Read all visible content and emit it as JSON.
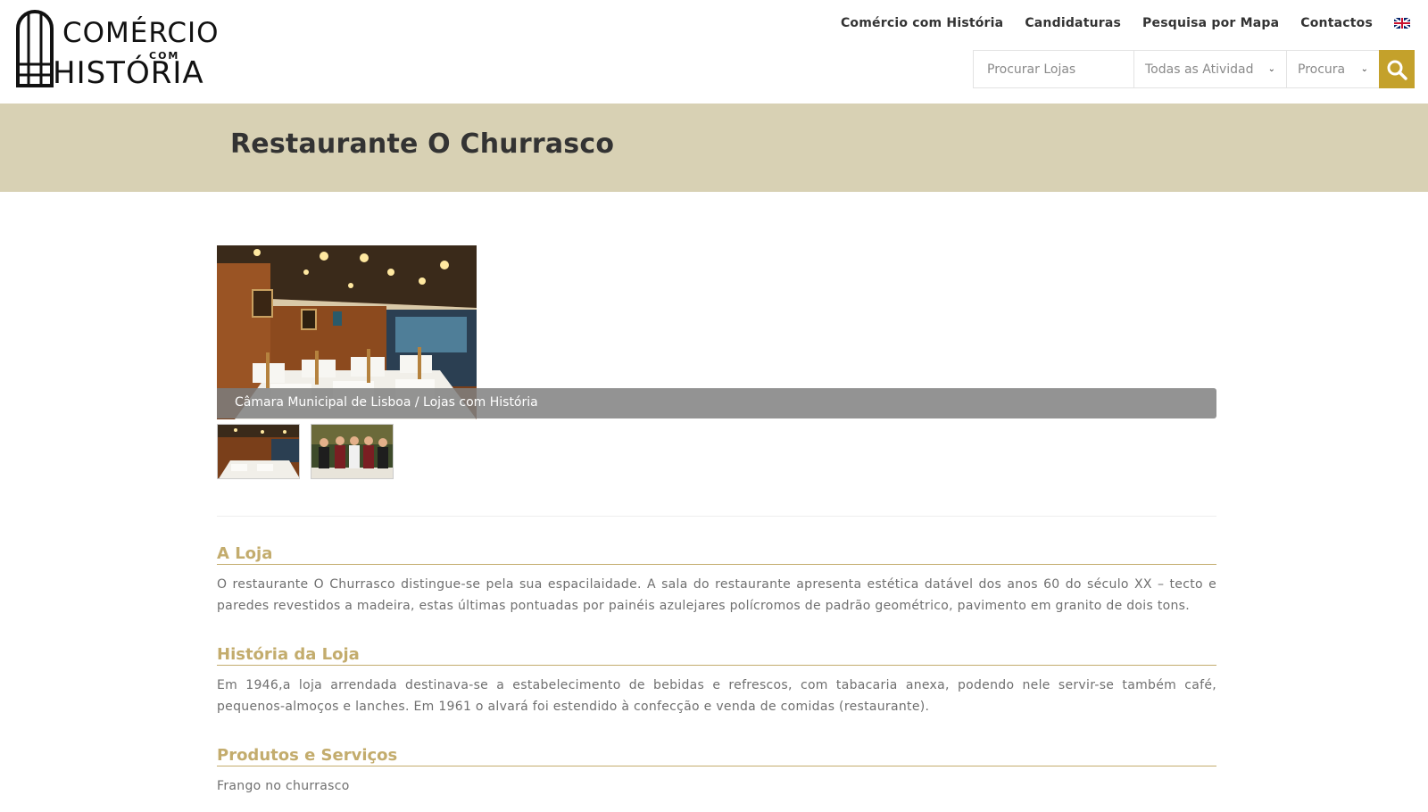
{
  "header": {
    "logo": {
      "line1": "COMÉRCIO",
      "line_com": "COM",
      "line2": "HISTÓRIA"
    },
    "nav": [
      {
        "label": "Comércio com História"
      },
      {
        "label": "Candidaturas"
      },
      {
        "label": "Pesquisa por Mapa"
      },
      {
        "label": "Contactos"
      }
    ],
    "language_icon": "uk-flag-icon",
    "search": {
      "placeholder": "Procurar Lojas",
      "activity_selected": "Todas as Atividad",
      "location_selected": "Procura",
      "button_icon": "search-icon",
      "button_color": "#c4a12b"
    }
  },
  "page": {
    "title": "Restaurante O Churrasco",
    "title_band_color": "#d8d1b4"
  },
  "gallery": {
    "caption": "Câmara Municipal de Lisboa / Lojas com História",
    "thumbnails": [
      "restaurant-interior-thumb",
      "staff-photo-thumb"
    ]
  },
  "sections": [
    {
      "heading": "A Loja",
      "text": "O restaurante O Churrasco distingue-se pela sua espacilaidade. A sala do restaurante apresenta estética datável dos anos 60 do século XX – tecto e paredes revestidos a madeira, estas últimas pontuadas por painéis azulejares polícromos de padrão geométrico, pavimento em granito de dois tons."
    },
    {
      "heading": "História da Loja",
      "text": "Em 1946,a loja arrendada destinava-se a estabelecimento de bebidas e refrescos, com tabacaria anexa, podendo nele servir-se também café, pequenos-almoços e lanches. Em 1961 o alvará foi estendido à confecção e venda de comidas (restaurante)."
    },
    {
      "heading": "Produtos e Serviços",
      "text": "Frango no churrasco"
    }
  ],
  "colors": {
    "accent": "#c3ac6d",
    "gold": "#c4a12b"
  }
}
